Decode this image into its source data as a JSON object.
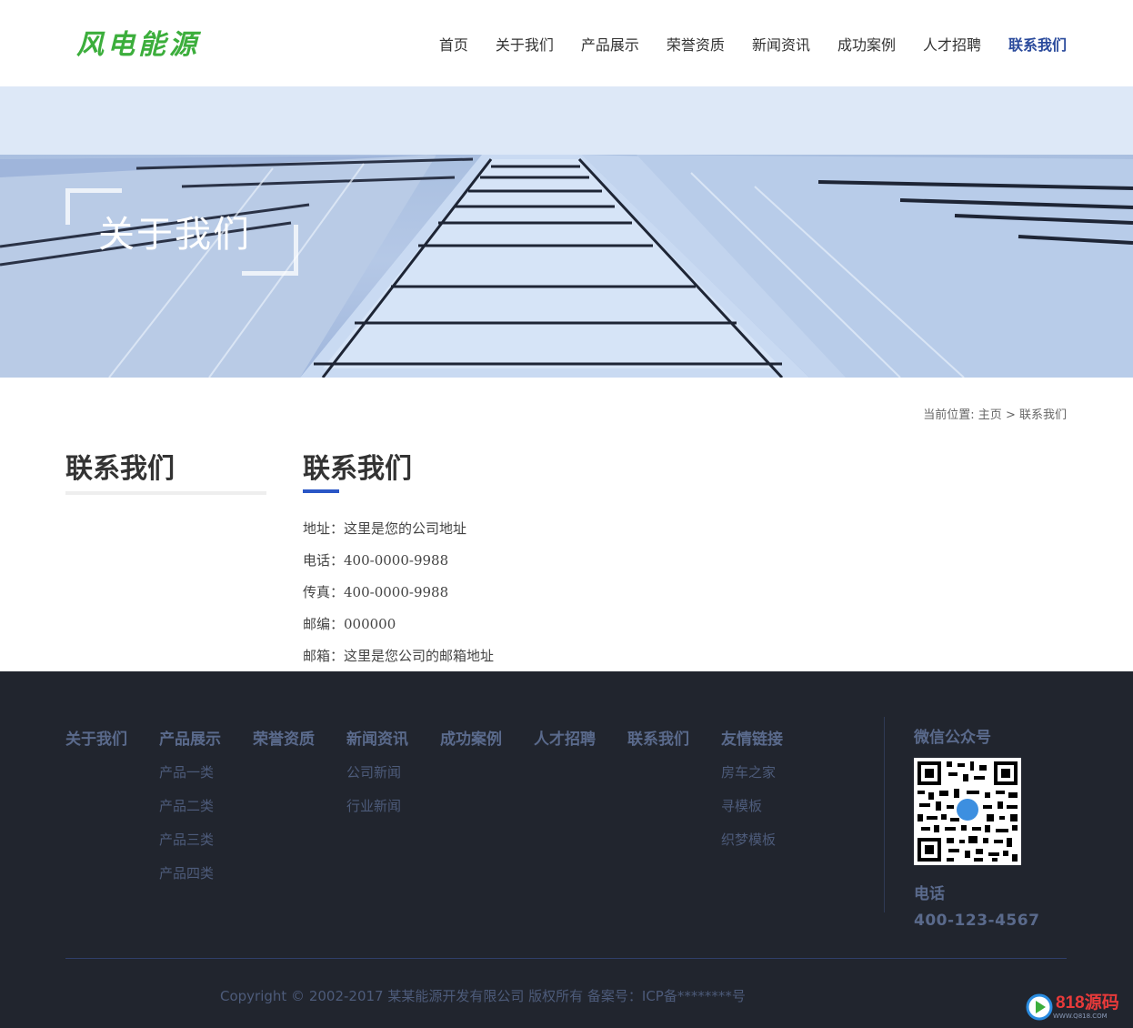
{
  "header": {
    "logo": "风电能源",
    "nav": [
      "首页",
      "关于我们",
      "产品展示",
      "荣誉资质",
      "新闻资讯",
      "成功案例",
      "人才招聘",
      "联系我们"
    ],
    "active_nav": "联系我们"
  },
  "banner": {
    "title": "关于我们"
  },
  "breadcrumb": {
    "prefix": "当前位置: ",
    "home": "主页",
    "sep": " > ",
    "current": "联系我们"
  },
  "sidebar": {
    "title": "联系我们"
  },
  "main": {
    "title": "联系我们",
    "contact": [
      "地址：这里是您的公司地址",
      "电话：400-0000-9988",
      "传真：400-0000-9988",
      "邮编：000000",
      "邮箱：这里是您公司的邮箱地址"
    ]
  },
  "footer": {
    "columns": [
      {
        "title": "关于我们",
        "items": []
      },
      {
        "title": "产品展示",
        "items": [
          "产品一类",
          "产品二类",
          "产品三类",
          "产品四类"
        ]
      },
      {
        "title": "荣誉资质",
        "items": []
      },
      {
        "title": "新闻资讯",
        "items": [
          "公司新闻",
          "行业新闻"
        ]
      },
      {
        "title": "成功案例",
        "items": []
      },
      {
        "title": "人才招聘",
        "items": []
      },
      {
        "title": "联系我们",
        "items": []
      },
      {
        "title": "友情链接",
        "items": [
          "房车之家",
          "寻模板",
          "织梦模板"
        ]
      }
    ],
    "wechat_title": "微信公众号",
    "phone_label": "电话",
    "phone_number": "400-123-4567",
    "copyright": "Copyright © 2002-2017 某某能源开发有限公司 版权所有 备案号：ICP备********号"
  },
  "watermark": {
    "text": "818源码",
    "sub": "WWW.Q818.COM"
  }
}
